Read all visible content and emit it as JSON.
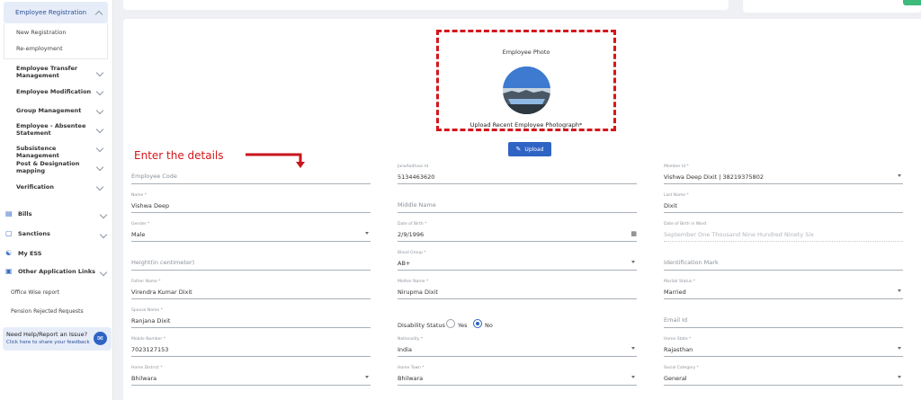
{
  "sidebar": {
    "open_section": "Employee Registration",
    "sub_items": [
      "New Registration",
      "Re-employment"
    ],
    "items": [
      "Employee Transfer Management",
      "Employee Modification",
      "Group Management",
      "Employee - Absentee Statement",
      "Subsistence Management",
      "Post & Designation mapping",
      "Verification"
    ],
    "main_items": [
      {
        "label": "Bills",
        "icon": "document-icon"
      },
      {
        "label": "Sanctions",
        "icon": "file-icon"
      },
      {
        "label": "My ESS",
        "icon": "users-icon"
      },
      {
        "label": "Other Application Links",
        "icon": "link-icon"
      }
    ],
    "links": [
      "Office Wise report",
      "Pension Rejected Requests"
    ],
    "help": {
      "title": "Need Help/Report an Issue?",
      "link": "Click here to share your feedback"
    }
  },
  "photo": {
    "title": "Employee Photo",
    "caption": "Upload Recent Employee Photograph*",
    "upload_label": "Upload"
  },
  "annotation": "Enter the details",
  "form": {
    "employee_code": {
      "placeholder": "Employee Code"
    },
    "janaadhaar": {
      "label": "JanaAadhaar Id",
      "value": "5134463620"
    },
    "member_id": {
      "label": "Member Id *",
      "value": "Vishwa Deep Dixit | 38219375802"
    },
    "name": {
      "label": "Name *",
      "value": "Vishwa Deep"
    },
    "middle_name": {
      "placeholder": "Middle Name"
    },
    "last_name": {
      "label": "Last Name *",
      "value": "Dixit"
    },
    "gender": {
      "label": "Gender *",
      "value": "Male"
    },
    "dob": {
      "label": "Date of Birth *",
      "value": "2/9/1996"
    },
    "dob_words": {
      "label": "Date of Birth in Word",
      "value": "September One Thousand Nine Hundred Ninety Six"
    },
    "height": {
      "placeholder": "Height(in centimeter)"
    },
    "blood_group": {
      "label": "Blood Group *",
      "value": "AB+"
    },
    "identification": {
      "placeholder": "Identification Mark"
    },
    "father": {
      "label": "Father Name *",
      "value": "Virendra Kumar Dixit"
    },
    "mother": {
      "label": "Mother Name *",
      "value": "Nirupma Dixit"
    },
    "marital": {
      "label": "Marital Status *",
      "value": "Married"
    },
    "spouse": {
      "label": "Spouse Name *",
      "value": "Ranjana Dixit"
    },
    "disability": {
      "question": "Disability Status",
      "yes": "Yes",
      "no": "No"
    },
    "email": {
      "placeholder": "Email Id"
    },
    "mobile": {
      "label": "Mobile Number *",
      "value": "7023127153"
    },
    "nationality": {
      "label": "Nationality *",
      "value": "India"
    },
    "home_state": {
      "label": "Home State *",
      "value": "Rajasthan"
    },
    "home_district": {
      "label": "Home District *",
      "value": "Bhilwara"
    },
    "home_town": {
      "label": "Home Town *",
      "value": "Bhilwara"
    },
    "social_category": {
      "label": "Social Category *",
      "value": "General"
    }
  }
}
